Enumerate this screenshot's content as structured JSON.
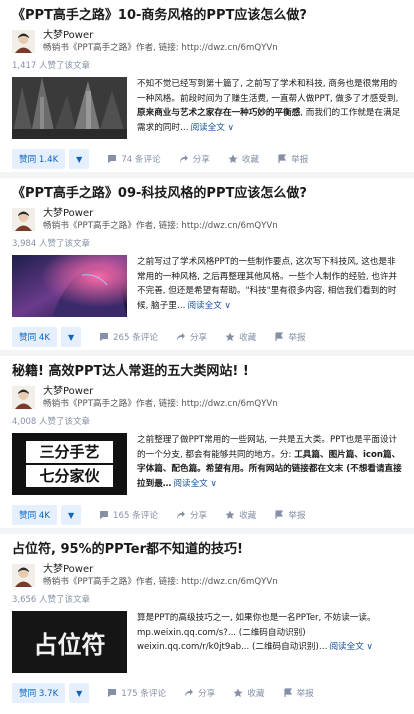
{
  "articles": [
    {
      "title": "《PPT高手之路》10-商务风格的PPT应该怎么做?",
      "author_name": "大梦Power",
      "author_bio": "畅销书《PPT高手之路》作者, 链接: http://dwz.cn/6mQYVn",
      "likes_text": "1,417 人赞了该文章",
      "excerpt_parts": [
        "不知不觉已经写到第十篇了, 之前写了学术和科技, 商务也是很常用的一种风格。前段时间为了赚生活费, 一直帮人做PPT, 做多了才感受到, ",
        "原来商业与艺术之家存在一种巧妙的平衡感",
        ", 而我们的工作就是在满足需求的同时…"
      ],
      "read_more": "阅读全文 ∨",
      "vote_label": "赞同 1.4K",
      "comments": "74 条评论",
      "share": "分享",
      "favorite": "收藏",
      "report": "举报"
    },
    {
      "title": "《PPT高手之路》09-科技风格的PPT应该怎么做?",
      "author_name": "大梦Power",
      "author_bio": "畅销书《PPT高手之路》作者, 链接: http://dwz.cn/6mQYVn",
      "likes_text": "3,984 人赞了该文章",
      "excerpt_parts": [
        "之前写过了学术风格PPT的一些制作要点, 这次写下科技风, 这也是非常用的一种风格, 之后再整理其他风格。一些个人制作的经验, 也许并不完善, 但还是希望有帮助。\"科技\"里有很多内容, 相信我们看到的时候, 脑子里…",
        "",
        ""
      ],
      "read_more": "阅读全文 ∨",
      "vote_label": "赞同 4K",
      "comments": "265 条评论",
      "share": "分享",
      "favorite": "收藏",
      "report": "举报"
    },
    {
      "title": "秘籍! 高效PPT达人常逛的五大类网站! !",
      "author_name": "大梦Power",
      "author_bio": "畅销书《PPT高手之路》作者, 链接: http://dwz.cn/6mQYVn",
      "likes_text": "4,008 人赞了该文章",
      "thumb_line1": "三分手艺",
      "thumb_line2": "七分家伙",
      "excerpt_parts": [
        "之前整理了做PPT常用的一些网站, 一共是五大类。PPT也是平面设计的一个分支, 都会有能够共同的地方。分: ",
        "工具篇、图片篇、icon篇、字体篇、配色篇",
        "。希望有用。所有网站的链接都在文末 (不想看请直接拉到最…"
      ],
      "read_more": "阅读全文 ∨",
      "vote_label": "赞同 4K",
      "comments": "165 条评论",
      "share": "分享",
      "favorite": "收藏",
      "report": "举报"
    },
    {
      "title": "占位符, 95%的PPTer都不知道的技巧!",
      "author_name": "大梦Power",
      "author_bio": "畅销书《PPT高手之路》作者, 链接: http://dwz.cn/6mQYVn",
      "likes_text": "3,656 人赞了该文章",
      "thumb_text": "占位符",
      "excerpt_parts": [
        "算是PPT的高级技巧之一, 如果你也是一名PPTer, 不妨读一读。mp.weixin.qq.com/s?... (二维码自动识别) weixin.qq.com/r/k0jt9ab... (二维码自动识别)…",
        "",
        ""
      ],
      "read_more": "阅读全文 ∨",
      "vote_label": "赞同 3.7K",
      "comments": "175 条评论",
      "share": "分享",
      "favorite": "收藏",
      "report": "举报"
    }
  ]
}
